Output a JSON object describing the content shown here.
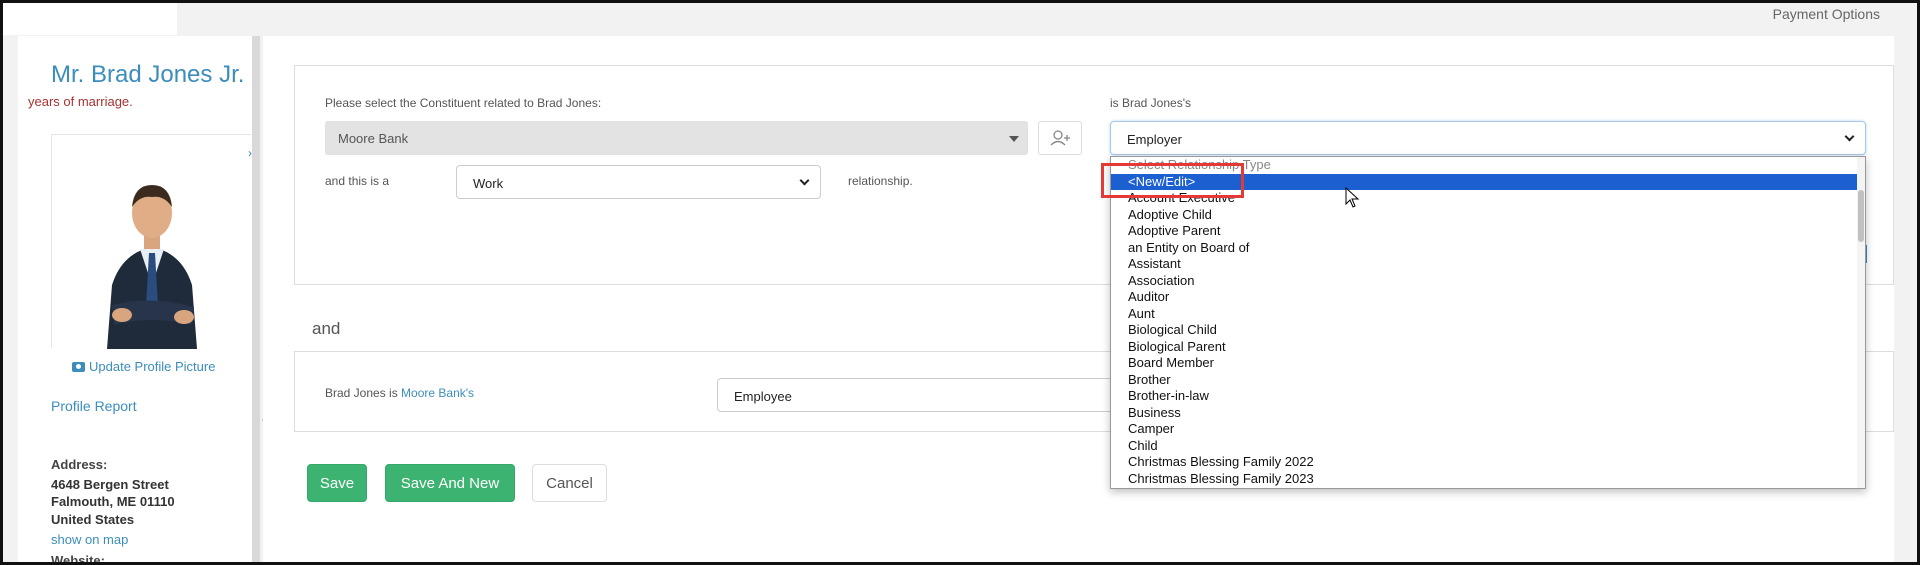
{
  "header": {
    "payment_options": "Payment Options"
  },
  "profile": {
    "name": "Mr. Brad Jones Jr.",
    "subtitle": "years of marriage.",
    "update_picture": "Update Profile Picture",
    "profile_report": "Profile Report",
    "address_label": "Address:",
    "address_lines": [
      "4648 Bergen Street",
      "Falmouth, ME 01110",
      "United States"
    ],
    "show_on_map": "show on map",
    "website_label": "Website:"
  },
  "relationship_form": {
    "constituent_prompt": "Please select the Constituent related to Brad Jones:",
    "constituent_value": "Moore Bank",
    "is_label": "is Brad Jones's",
    "relationship_type_value": "Employer",
    "and_this_is_a": "and this is a",
    "category_value": "Work",
    "relationship_suffix": "relationship.",
    "and_label": "and",
    "reciprocal_prefix": "Brad Jones is",
    "reciprocal_link": "Moore Bank's",
    "reciprocal_value": "Employee"
  },
  "buttons": {
    "save": "Save",
    "save_and_new": "Save And New",
    "cancel": "Cancel"
  },
  "dropdown": {
    "placeholder": "Select Relationship Type",
    "selected": "<New/Edit>",
    "options": [
      "Account Executive",
      "Adoptive Child",
      "Adoptive Parent",
      "an Entity on Board of",
      "Assistant",
      "Association",
      "Auditor",
      "Aunt",
      "Biological Child",
      "Biological Parent",
      "Board Member",
      "Brother",
      "Brother-in-law",
      "Business",
      "Camper",
      "Child",
      "Christmas Blessing Family 2022",
      "Christmas Blessing Family 2023"
    ]
  },
  "colors": {
    "accent": "#3c8dbc",
    "save_green": "#3cb371",
    "selected_option": "#1b5fd0",
    "highlight_box": "#e53935"
  }
}
